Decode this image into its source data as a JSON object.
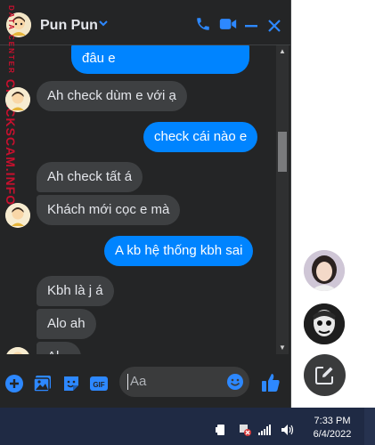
{
  "header": {
    "name": "Pun Pun",
    "icons": [
      "chevron-down-icon",
      "phone-icon",
      "video-icon",
      "minimize-icon",
      "close-icon"
    ]
  },
  "watermark": {
    "small": "DATA CENTER",
    "main": "CHECKSCAM.INFO"
  },
  "messages": [
    {
      "side": "out",
      "text": "đâu e"
    },
    {
      "side": "in",
      "text": "Ah check dùm e với ạ"
    },
    {
      "side": "out",
      "text": "check cái nào e"
    },
    {
      "side": "in",
      "text": "Ah check tất á"
    },
    {
      "side": "in",
      "text": "Khách mới cọc e mà"
    },
    {
      "side": "out",
      "text": "A kb hệ thống kbh sai"
    },
    {
      "side": "in",
      "text": "Kbh là j á"
    },
    {
      "side": "in",
      "text": "Alo ah"
    },
    {
      "side": "in",
      "text": "Al..."
    }
  ],
  "composer": {
    "placeholder": "Aa",
    "icons": [
      "add-icon",
      "photo-icon",
      "sticker-icon",
      "gif-icon",
      "emoji-icon",
      "like-icon"
    ],
    "gif_label": "GIF"
  },
  "taskbar": {
    "time": "7:33 PM",
    "date": "6/4/2022"
  },
  "colors": {
    "accent": "#0084ff",
    "chat_bg": "#242526",
    "bubble_in": "#3e4042",
    "taskbar": "#1f2a44"
  }
}
